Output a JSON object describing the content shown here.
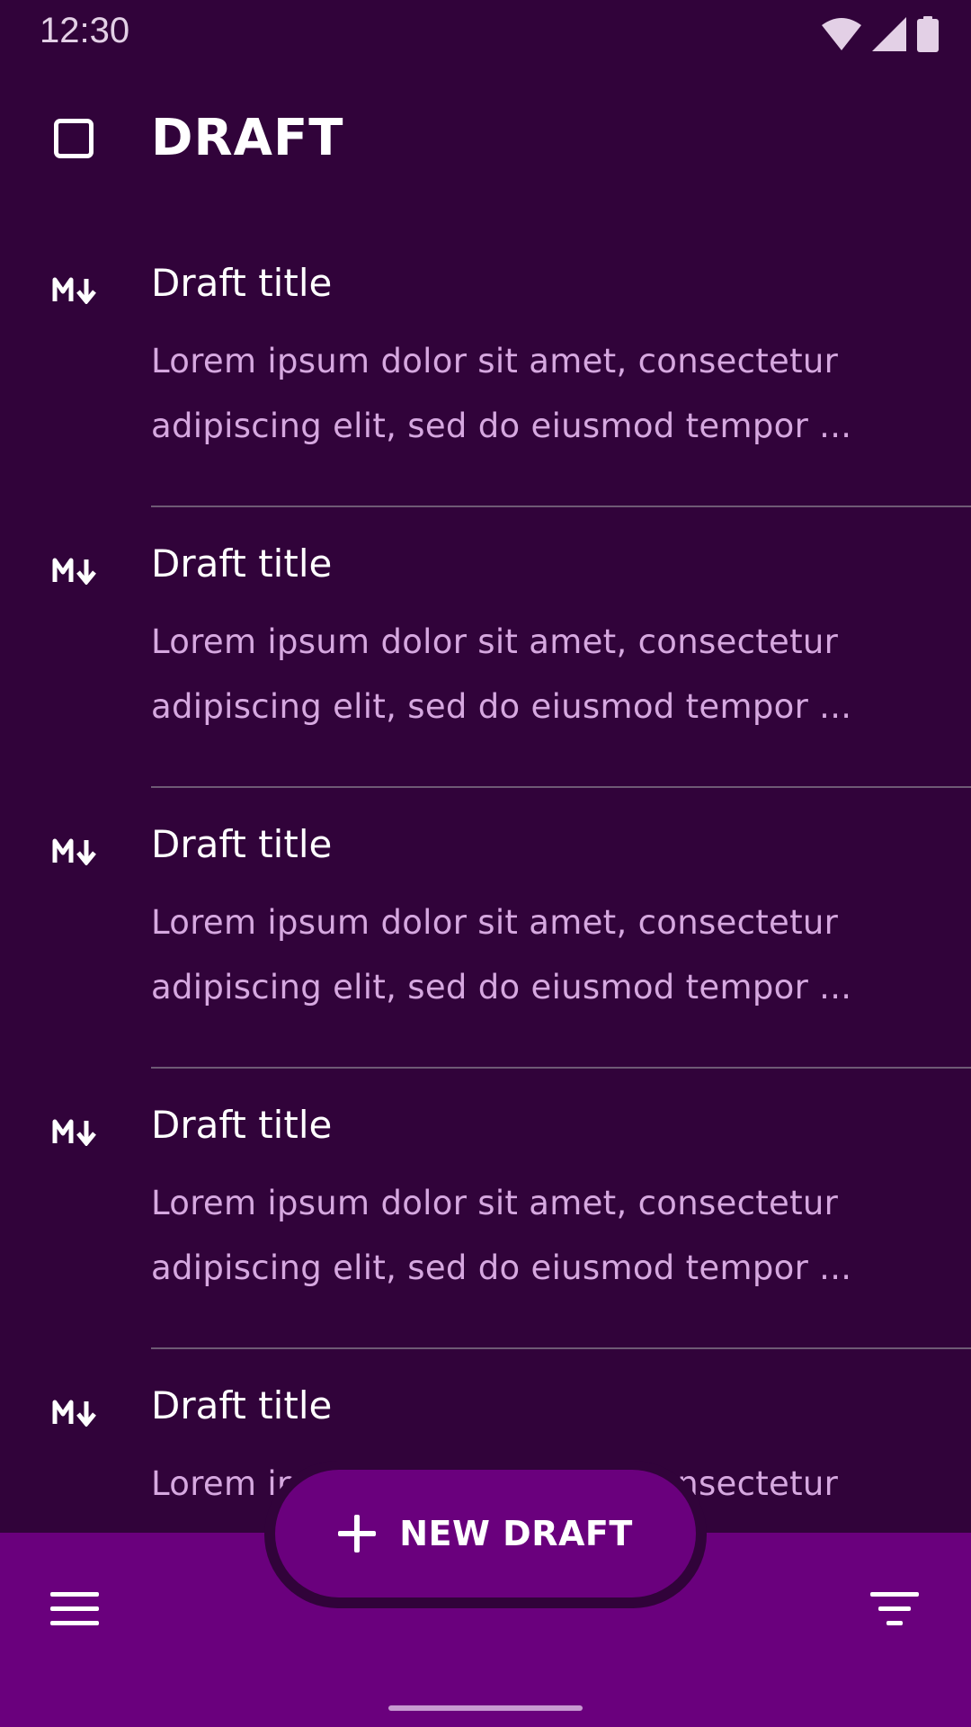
{
  "status_bar": {
    "time": "12:30",
    "icons": [
      "wifi-icon",
      "cell-signal-icon",
      "battery-icon"
    ]
  },
  "header": {
    "title": "DRAFT",
    "checkbox_icon": "checkbox-outline-icon"
  },
  "drafts": [
    {
      "icon": "markdown-icon",
      "title": "Draft title",
      "body": "Lorem ipsum dolor sit amet, consectetur adipiscing elit, sed do eiusmod tempor ..."
    },
    {
      "icon": "markdown-icon",
      "title": "Draft title",
      "body": "Lorem ipsum dolor sit amet, consectetur adipiscing elit, sed do eiusmod tempor ..."
    },
    {
      "icon": "markdown-icon",
      "title": "Draft title",
      "body": "Lorem ipsum dolor sit amet, consectetur adipiscing elit, sed do eiusmod tempor ..."
    },
    {
      "icon": "markdown-icon",
      "title": "Draft title",
      "body": "Lorem ipsum dolor sit amet, consectetur adipiscing elit, sed do eiusmod tempor ..."
    },
    {
      "icon": "markdown-icon",
      "title": "Draft title",
      "body": "Lorem ipsum dolor sit amet, consectetur adipiscing elit, sed do eiusmod tempor ..."
    }
  ],
  "bottom_bar": {
    "menu_icon": "menu-icon",
    "filter_icon": "filter-icon",
    "fab_icon": "plus-icon",
    "fab_label": "NEW DRAFT"
  },
  "colors": {
    "background": "#31033a",
    "bar": "#6a007d",
    "body_text": "#d6a8e0",
    "divider": "#6e5a75"
  }
}
